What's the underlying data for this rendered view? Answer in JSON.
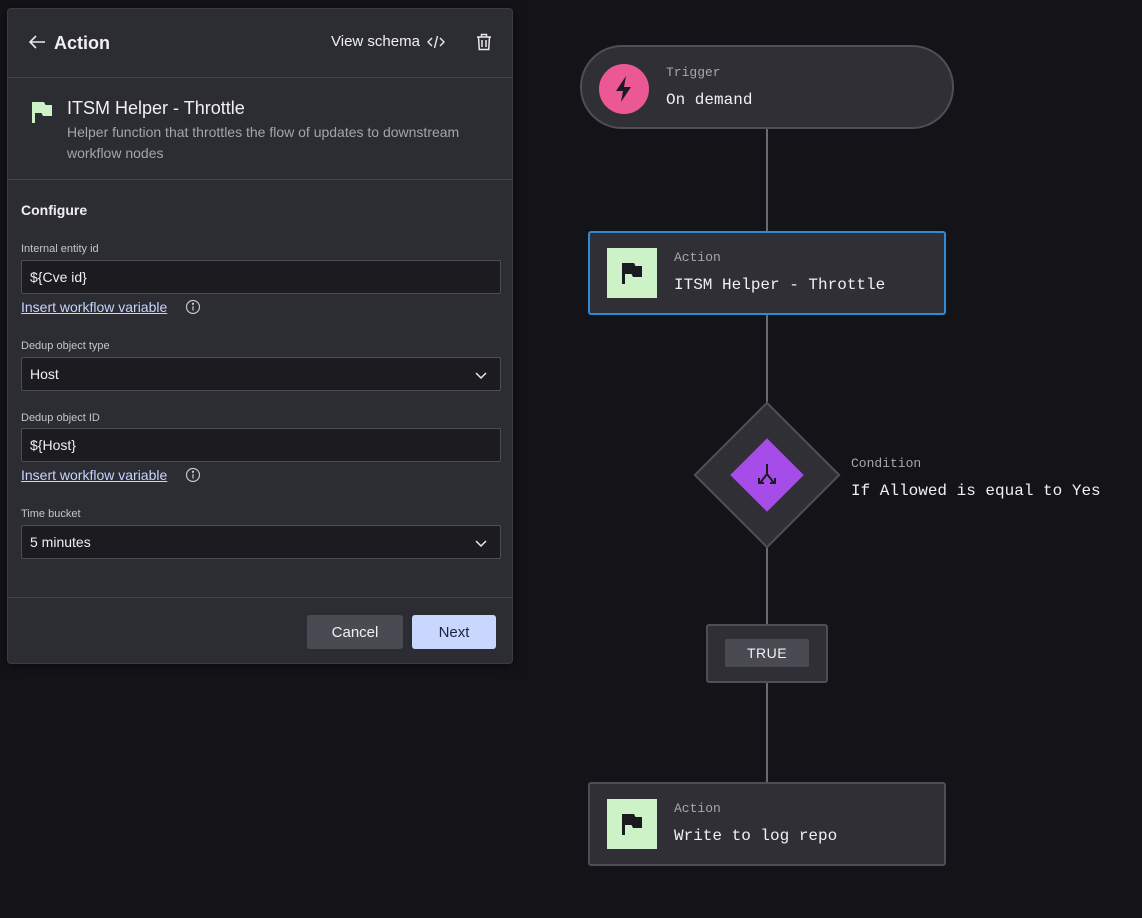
{
  "panel": {
    "title": "Action",
    "view_schema_label": "View schema",
    "action_name": "ITSM Helper - Throttle",
    "action_description": "Helper function that throttles the flow of updates to downstream workflow nodes",
    "configure_label": "Configure",
    "fields": {
      "internal_entity_id": {
        "label": "Internal entity id",
        "value": "${Cve id}"
      },
      "dedup_object_type": {
        "label": "Dedup object type",
        "value": "Host"
      },
      "dedup_object_id": {
        "label": "Dedup object ID",
        "value": "${Host}"
      },
      "time_bucket": {
        "label": "Time bucket",
        "value": "5 minutes"
      }
    },
    "insert_variable_label": "Insert workflow variable",
    "cancel_label": "Cancel",
    "next_label": "Next"
  },
  "flow": {
    "trigger": {
      "label": "Trigger",
      "text": "On demand"
    },
    "action1": {
      "label": "Action",
      "text": "ITSM Helper - Throttle"
    },
    "condition": {
      "label": "Condition",
      "text": "If Allowed is equal to Yes"
    },
    "branch": {
      "text": "TRUE"
    },
    "action2": {
      "label": "Action",
      "text": "Write to log repo"
    }
  },
  "colors": {
    "background": "#141418",
    "panel": "#2c2c33",
    "trigger_icon": "#ec5893",
    "action_icon": "#cdf2c7",
    "condition_icon": "#a64ce8",
    "selected_border": "#2d8bdb",
    "link": "#c8d4ff",
    "next_button": "#c9d7ff"
  },
  "icons": [
    "back-arrow-icon",
    "code-icon",
    "trash-icon",
    "flag-icon",
    "info-icon",
    "chevron-down-icon",
    "lightning-icon",
    "merge-icon"
  ]
}
